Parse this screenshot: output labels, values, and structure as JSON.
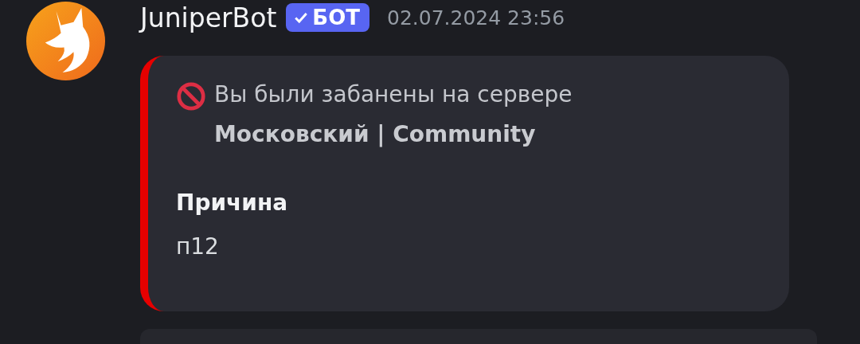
{
  "message": {
    "author": "JuniperBot",
    "badge": "БОТ",
    "timestamp": "02.07.2024 23:56",
    "embed": {
      "title": "Вы были забанены на сервере **Московский | Community**",
      "fields": [
        {
          "name": "Причина",
          "value": "п12"
        }
      ]
    }
  }
}
